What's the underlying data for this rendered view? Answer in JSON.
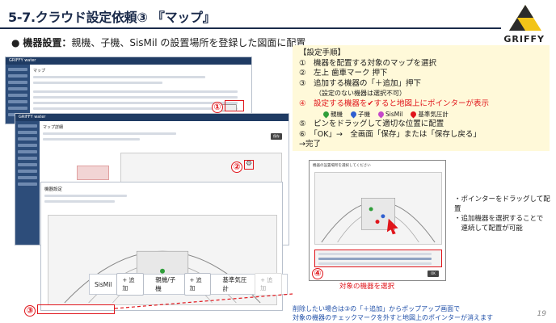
{
  "header": {
    "title": "5-7.クラウド設定依頼③ 『マップ』",
    "logo_text": "GRIFFY"
  },
  "bullet": {
    "bold": "機器設置：",
    "text": "親機、子機、SisMil の設置場所を登録した図面に配置"
  },
  "screens": {
    "app_name": "GRIFFY water",
    "screen1_title": "マップ",
    "screen2_title": "マップ詳細",
    "screen2_button": "保存",
    "screen3_title": "機器設定"
  },
  "steps": {
    "heading": "【設定手順】",
    "s1": "①　機器を配置する対象のマップを選択",
    "s2": "②　左上 歯車マーク 押下",
    "s3": "③　追加する機器の「＋追加」押下",
    "s3_note": "（設定のない機器は選択不可）",
    "s4": "④　設定する機器を✔すると地図上にポインターが表示",
    "legend": [
      "親機",
      "子機",
      "SisMil",
      "基準気圧計"
    ],
    "s5": "⑤　ピンをドラッグして適切な位置に配置",
    "s6": "⑥　「OK」→　全画面「保存」または「保存し戻る」",
    "s7": "→完了"
  },
  "colors": {
    "parent": "#2f9e3a",
    "child": "#2f5fd0",
    "sismil": "#c548c9",
    "barometer": "#e0151b"
  },
  "markers": {
    "m1": "①",
    "m2": "②",
    "m3": "③",
    "m4": "④"
  },
  "device_bar": {
    "sismil_label": "SisMil",
    "sismil_add": "+ 追加",
    "parent_child_label": "親機/子機",
    "parent_child_add": "+ 追加",
    "barometer_label": "基準気圧計",
    "barometer_add": "+ 追加"
  },
  "dialog": {
    "title": "機器の設置場所を選択してください",
    "ok": "OK",
    "select_label": "対象の機器を選択"
  },
  "notes": {
    "right": [
      "・ポインターをドラッグして配置",
      "・追加機器を選択することで",
      "　連続して配置が可能"
    ],
    "bottom": [
      "削除したい場合は③の「＋追加」からポップアップ画面で",
      "対象の機器のチェックマークを外すと地図上のポインターが消えます"
    ]
  },
  "page_number": "19"
}
